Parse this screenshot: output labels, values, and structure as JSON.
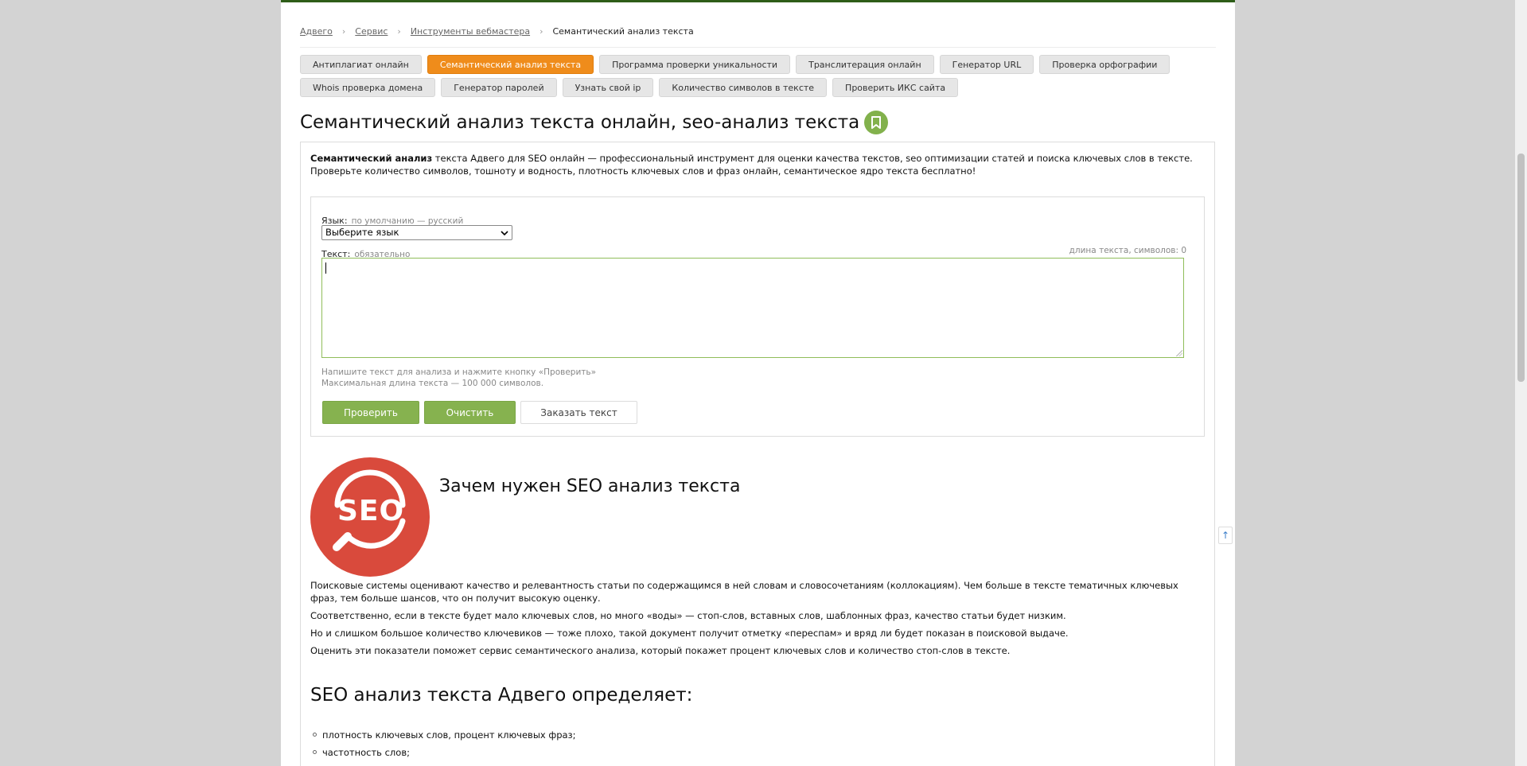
{
  "breadcrumbs": {
    "items": [
      "Адвего",
      "Сервис",
      "Инструменты вебмастера"
    ],
    "current": "Семантический анализ текста"
  },
  "tabs": [
    {
      "label": "Антиплагиат онлайн",
      "active": false
    },
    {
      "label": "Семантический анализ текста",
      "active": true
    },
    {
      "label": "Программа проверки уникальности",
      "active": false
    },
    {
      "label": "Транслитерация онлайн",
      "active": false
    },
    {
      "label": "Генератор URL",
      "active": false
    },
    {
      "label": "Проверка орфографии",
      "active": false
    },
    {
      "label": "Whois проверка домена",
      "active": false
    },
    {
      "label": "Генератор паролей",
      "active": false
    },
    {
      "label": "Узнать свой ip",
      "active": false
    },
    {
      "label": "Количество символов в тексте",
      "active": false
    },
    {
      "label": "Проверить ИКС сайта",
      "active": false
    }
  ],
  "page_title": "Семантический анализ текста онлайн, seo-анализ текста",
  "intro": {
    "bold": "Семантический анализ",
    "rest": " текста Адвего для SEO онлайн — профессиональный инструмент для оценки качества текстов, seo оптимизации статей и поиска ключевых слов в тексте. Проверьте количество символов, тошноту и водность, плотность ключевых слов и фраз онлайн, семантическое ядро текста бесплатно!"
  },
  "form": {
    "language_label": "Язык:",
    "language_hint": "по умолчанию — русский",
    "language_select_value": "Выберите язык",
    "text_label": "Текст:",
    "text_hint": "обязательно",
    "length_label": "длина текста, символов: 0",
    "text_value": "",
    "hint_line1": "Напишите текст для анализа и нажмите кнопку «Проверить»",
    "hint_line2": "Максимальная длина текста — 100 000 символов.",
    "check_button": "Проверить",
    "clear_button": "Очистить",
    "order_button": "Заказать текст"
  },
  "seo_section": {
    "logo_text": "SEO",
    "heading": "Зачем нужен SEO анализ текста",
    "paragraphs": [
      "Поисковые системы оценивают качество и релевантность статьи по содержащимся в ней словам и словосочетаниям (коллокациям). Чем больше в тексте тематичных ключевых фраз, тем больше шансов, что он получит высокую оценку.",
      "Соответственно, если в тексте будет мало ключевых слов, но много «воды» — стоп-слов, вставных слов, шаблонных фраз, качество статьи будет низким.",
      "Но и слишком большое количество ключевиков — тоже плохо, такой документ получит отметку «переспам» и вряд ли будет показан в поисковой выдаче.",
      "Оценить эти показатели поможет сервис семантического анализа, который покажет процент ключевых слов и количество стоп-слов в тексте."
    ]
  },
  "defines": {
    "heading": "SEO анализ текста Адвего определяет:",
    "items": [
      "плотность ключевых слов, процент ключевых фраз;",
      "частотность слов;"
    ]
  },
  "scroll_top_icon": "arrow-up-icon",
  "colors": {
    "accent_orange": "#ef8c1b",
    "button_green": "#86b24f",
    "header_green": "#2e5d18",
    "seo_red": "#d94a3c"
  }
}
